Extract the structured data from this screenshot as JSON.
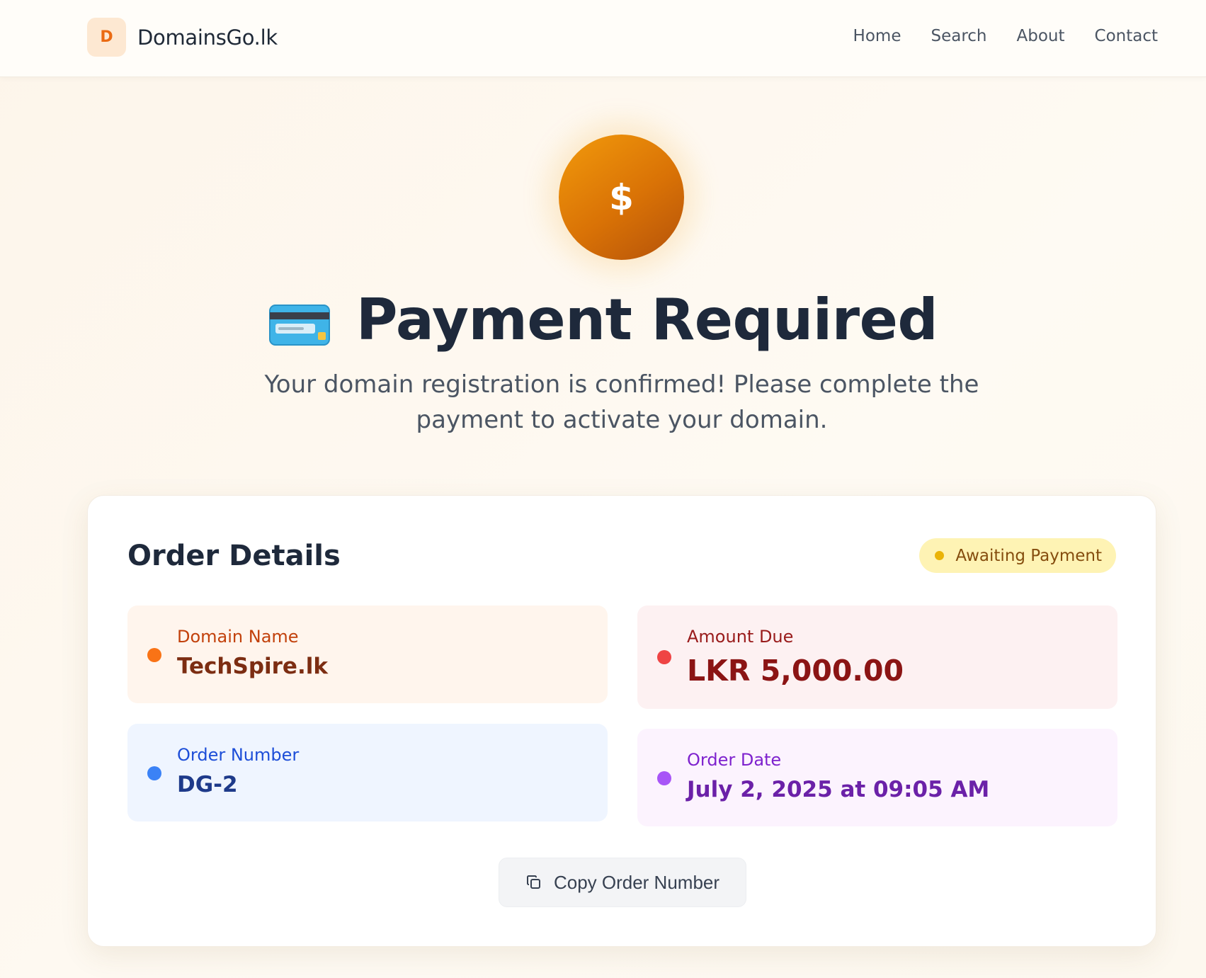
{
  "navbar": {
    "logo_letter": "D",
    "brand_name": "DomainsGo.lk",
    "links": [
      {
        "label": "Home"
      },
      {
        "label": "Search"
      },
      {
        "label": "About"
      },
      {
        "label": "Contact"
      }
    ]
  },
  "hero": {
    "icon_symbol": "$",
    "title_icon": "credit-card-icon",
    "title": "Payment Required",
    "subtitle": "Your domain registration is confirmed! Please complete the payment to activate your domain."
  },
  "order": {
    "title": "Order Details",
    "status": "Awaiting Payment",
    "details": {
      "domain": {
        "label": "Domain Name",
        "value": "TechSpire.lk"
      },
      "amount": {
        "label": "Amount Due",
        "value": "LKR 5,000.00"
      },
      "order_number": {
        "label": "Order Number",
        "value": "DG-2"
      },
      "order_date": {
        "label": "Order Date",
        "value": "July 2, 2025 at 09:05 AM"
      }
    },
    "copy_button_label": "Copy Order Number"
  },
  "colors": {
    "brand_accent": "#ea6a12",
    "hero_icon_start": "#f29a0b",
    "hero_icon_end": "#b4520a",
    "status_badge_bg": "#fef3b4",
    "status_dot": "#eab308",
    "domain_dot": "#f97316",
    "amount_dot": "#ef4444",
    "order_number_dot": "#3b82f6",
    "order_date_dot": "#a855f7"
  }
}
